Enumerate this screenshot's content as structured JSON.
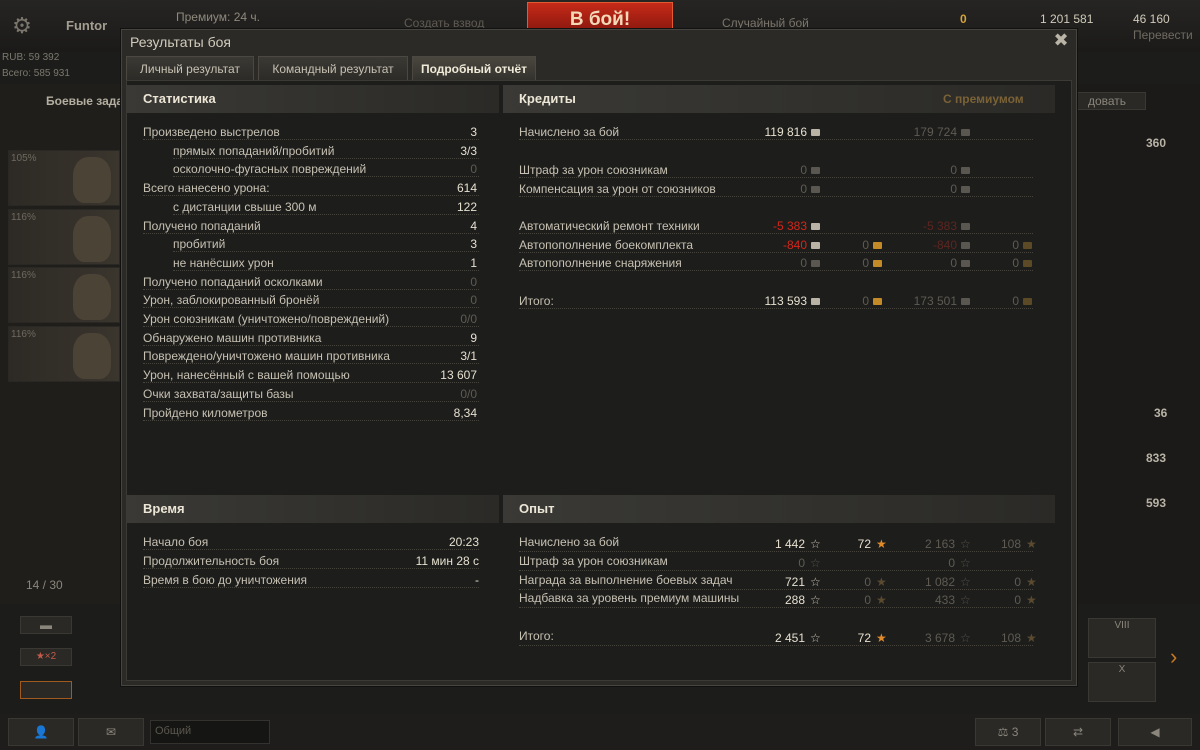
{
  "topbar": {
    "user": "Funtor",
    "rub": "RUB: 59 392",
    "all": "Всего: 585 931",
    "premium": "Премиум: 24 ч.",
    "platoon": "Создать взвод",
    "battle": "В бой!",
    "random": "Случайный бой",
    "gold": "0",
    "credits": "1 201 581",
    "exp": "46 160",
    "convert": "Перевести"
  },
  "left": {
    "missions": "Боевые задач",
    "crew_pct": [
      "105%",
      "116%",
      "116%",
      "116%"
    ],
    "tank_count": "14 / 30",
    "x2": "★×2"
  },
  "right": {
    "numbers": [
      "360",
      "36",
      "833",
      "593"
    ],
    "research": "довать",
    "tier8": "VIII",
    "tier10": "X"
  },
  "bottom": {
    "channel": "Общий",
    "count": "3"
  },
  "dialog": {
    "title": "Результаты боя",
    "tabs": [
      "Личный результат",
      "Командный результат",
      "Подробный отчёт"
    ],
    "stats": {
      "title": "Статистика",
      "rows": [
        {
          "label": "Произведено выстрелов",
          "value": "3",
          "indent": false,
          "dim": false
        },
        {
          "label": "прямых попаданий/пробитий",
          "value": "3/3",
          "indent": true,
          "dim": false
        },
        {
          "label": "осколочно-фугасных повреждений",
          "value": "0",
          "indent": true,
          "dim": true
        },
        {
          "label": "Всего нанесено урона:",
          "value": "614",
          "indent": false,
          "dim": false
        },
        {
          "label": "с дистанции свыше 300 м",
          "value": "122",
          "indent": true,
          "dim": false
        },
        {
          "label": "Получено попаданий",
          "value": "4",
          "indent": false,
          "dim": false
        },
        {
          "label": "пробитий",
          "value": "3",
          "indent": true,
          "dim": false
        },
        {
          "label": "не нанёсших урон",
          "value": "1",
          "indent": true,
          "dim": false
        },
        {
          "label": "Получено попаданий осколками",
          "value": "0",
          "indent": false,
          "dim": true
        },
        {
          "label": "Урон, заблокированный бронёй",
          "value": "0",
          "indent": false,
          "dim": true
        },
        {
          "label": "Урон союзникам (уничтожено/повреждений)",
          "value": "0/0",
          "indent": false,
          "dim": true
        },
        {
          "label": "Обнаружено машин противника",
          "value": "9",
          "indent": false,
          "dim": false
        },
        {
          "label": "Повреждено/уничтожено машин противника",
          "value": "3/1",
          "indent": false,
          "dim": false
        },
        {
          "label": "Урон, нанесённый с вашей помощью",
          "value": "13 607",
          "indent": false,
          "dim": false
        },
        {
          "label": "Очки захвата/защиты базы",
          "value": "0/0",
          "indent": false,
          "dim": true
        },
        {
          "label": "Пройдено километров",
          "value": "8,34",
          "indent": false,
          "dim": false
        }
      ]
    },
    "credits": {
      "title": "Кредиты",
      "premium_title": "С премиумом",
      "rows": [
        {
          "label": "Начислено за бой",
          "c": "119 816",
          "cs": "normal",
          "g": "",
          "pc": "179 724",
          "pg": ""
        },
        {
          "label": "Штраф за урон союзникам",
          "c": "0",
          "cs": "dim",
          "g": "",
          "pc": "0",
          "pg": ""
        },
        {
          "label": "Компенсация за урон от союзников",
          "c": "0",
          "cs": "dim",
          "g": "",
          "pc": "0",
          "pg": ""
        },
        {
          "label": "Автоматический ремонт техники",
          "c": "-5 383",
          "cs": "red",
          "g": "",
          "pc": "-5 383",
          "pg": ""
        },
        {
          "label": "Автопополнение боекомплекта",
          "c": "-840",
          "cs": "red",
          "g": "0",
          "pc": "-840",
          "pg": "0"
        },
        {
          "label": "Автопополнение снаряжения",
          "c": "0",
          "cs": "dim",
          "g": "0",
          "pc": "0",
          "pg": "0"
        },
        {
          "label": "Итого:",
          "c": "113 593",
          "cs": "normal",
          "g": "0",
          "pc": "173 501",
          "pg": "0"
        }
      ]
    },
    "time": {
      "title": "Время",
      "rows": [
        {
          "label": "Начало боя",
          "value": "20:23"
        },
        {
          "label": "Продолжительность боя",
          "value": "11 мин 28 с"
        },
        {
          "label": "Время в бою до уничтожения",
          "value": "-"
        }
      ]
    },
    "exp": {
      "title": "Опыт",
      "rows": [
        {
          "label": "Начислено за бой",
          "x": "1 442",
          "xs": "normal",
          "f": "72",
          "fs": "gold",
          "px": "2 163",
          "pf": "108"
        },
        {
          "label": "Штраф за урон союзникам",
          "x": "0",
          "xs": "dim",
          "f": "",
          "fs": "",
          "px": "0",
          "pf": ""
        },
        {
          "label": "Награда за выполнение боевых задач",
          "x": "721",
          "xs": "normal",
          "f": "0",
          "fs": "dim",
          "px": "1 082",
          "pf": "0"
        },
        {
          "label": "Надбавка за уровень премиум машины",
          "x": "288",
          "xs": "normal",
          "f": "0",
          "fs": "dim",
          "px": "433",
          "pf": "0"
        },
        {
          "label": "Итого:",
          "x": "2 451",
          "xs": "normal",
          "f": "72",
          "fs": "gold",
          "px": "3 678",
          "pf": "108"
        }
      ]
    }
  }
}
